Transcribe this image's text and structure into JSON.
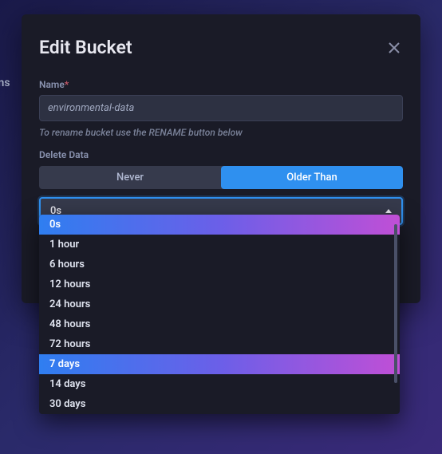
{
  "background": {
    "partial_text": "ens"
  },
  "modal": {
    "title": "Edit Bucket",
    "name_field": {
      "label": "Name",
      "required_marker": "*",
      "value": "environmental-data",
      "help": "To rename bucket use the RENAME button below"
    },
    "delete_section": {
      "label": "Delete Data",
      "options": {
        "never": "Never",
        "older_than": "Older Than"
      },
      "select": {
        "current": "0s",
        "items": [
          "0s",
          "1 hour",
          "6 hours",
          "12 hours",
          "24 hours",
          "48 hours",
          "72 hours",
          "7 days",
          "14 days",
          "30 days"
        ]
      }
    }
  }
}
